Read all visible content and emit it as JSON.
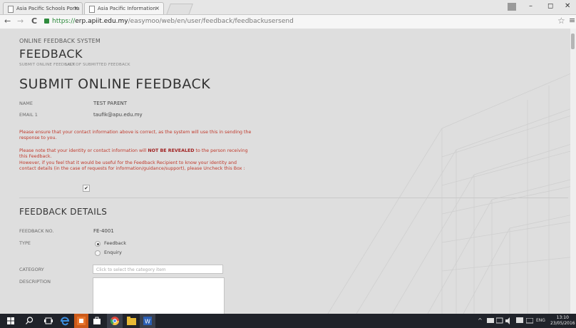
{
  "browser": {
    "tabs": [
      {
        "title": "Asia Pacific Schools Porta",
        "close": "×",
        "active": false
      },
      {
        "title": "Asia Pacific Information",
        "close": "×",
        "active": true
      }
    ],
    "window_controls": {
      "minimize": "–",
      "maximize": "◻",
      "close": "✕"
    },
    "url": {
      "scheme": "https://",
      "domain": "erp.apiit.edu.my",
      "path": "/easymoo/web/en/user/feedback/feedbackusersend"
    },
    "nav": {
      "back": "←",
      "forward": "→",
      "reload": "C"
    },
    "star": "☆",
    "menu": "≡"
  },
  "page": {
    "system_label": "ONLINE FEEDBACK SYSTEM",
    "module_title": "FEEDBACK",
    "subnav": [
      "SUBMIT ONLINE FEEDBACK",
      "LIST OF SUBMITTED FEEDBACK"
    ],
    "heading": "SUBMIT ONLINE FEEDBACK",
    "fields": {
      "name_label": "NAME",
      "name_value": "TEST PARENT",
      "email_label": "EMAIL 1",
      "email_value": "taufik@apu.edu.my"
    },
    "notice1": "Please ensure that your contact information above is correct, as the system will use this in sending the response to you.",
    "notice2": {
      "prefix": "Please note that your identity or contact information will ",
      "bold": "NOT BE REVEALED",
      "suffix": " to the person receiving this Feedback.",
      "line2": "However, if you feel that it would be useful for the Feedback Recipient to know your identity and contact details (in the case of requests for information/guidance/support), please Uncheck this Box :"
    },
    "checkbox_mark": "✔",
    "details_heading": "FEEDBACK DETAILS",
    "feedback_no_label": "FEEDBACK NO.",
    "feedback_no_value": "FE-4001",
    "type_label": "TYPE",
    "type_options": [
      {
        "label": "Feedback",
        "selected": true
      },
      {
        "label": "Enquiry",
        "selected": false
      }
    ],
    "category_label": "CATEGORY",
    "category_placeholder": "Click to select the category item",
    "description_label": "DESCRIPTION"
  },
  "taskbar": {
    "tray_lang": "ENG",
    "time": "13:10",
    "date": "23/05/2016"
  },
  "colors": {
    "notice_red": "#c0392b",
    "taskbar": "#20232a",
    "secure_green": "#2e8b3d"
  }
}
